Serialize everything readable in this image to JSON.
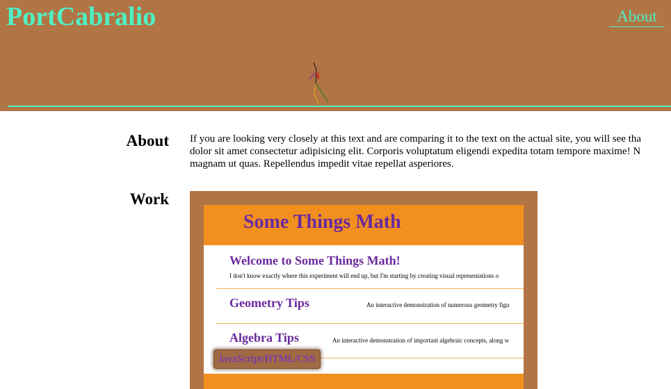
{
  "header": {
    "site_title": "PortCabralio",
    "nav_about": "About"
  },
  "colors": {
    "header_bg": "#b17445",
    "accent": "#4ff0c4",
    "preview_orange": "#f2901f",
    "preview_purple": "#6a2a9e"
  },
  "about": {
    "heading": "About",
    "lines": [
      "If you are looking very closely at this text and are comparing it to the text on the actual site, you will see tha",
      "dolor sit amet consectetur adipisicing elit. Corporis voluptatum eligendi expedita totam tempore maxime! N",
      "magnam ut quas. Repellendus impedit vitae repellat asperiores."
    ]
  },
  "work": {
    "heading": "Work",
    "project": {
      "preview": {
        "title": "Some Things Math",
        "welcome": "Welcome to Some Things Math!",
        "intro": "I don't know exactly where this experiment will end up, but I'm starting by creating visual representations o",
        "sections": [
          {
            "title": "Geometry Tips",
            "desc": "An interactive demonstration of numerous geometry figu"
          },
          {
            "title": "Algebra Tips",
            "desc": "An interactive demonstration of important algebraic concepts, along w"
          }
        ]
      },
      "tech_tag": "JavaScript/HTML/CSS"
    }
  },
  "icons": {
    "stick_figure": "stick-figure-icon"
  }
}
